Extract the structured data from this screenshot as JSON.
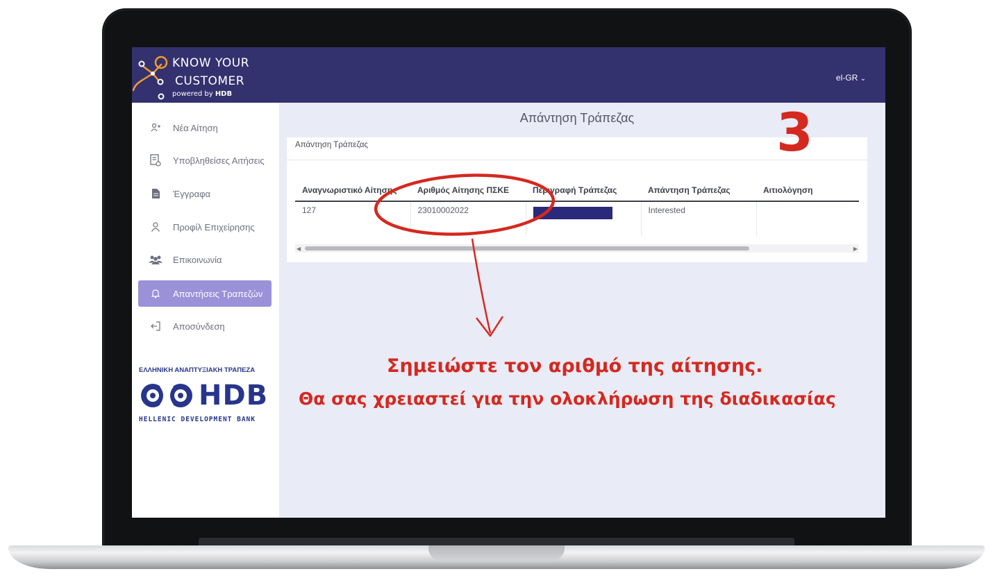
{
  "app": {
    "logo": {
      "line1": "KNOW YOUR",
      "line2": "CUSTOMER",
      "powered_prefix": "powered by ",
      "powered_brand": "HDB"
    },
    "language": "el-GR"
  },
  "sidebar": {
    "items": [
      {
        "label": "Νέα Αίτηση",
        "icon": "add-user-icon"
      },
      {
        "label": "Υποβληθείσες Αιτήσεις",
        "icon": "document-list-icon"
      },
      {
        "label": "Έγγραφα",
        "icon": "document-icon"
      },
      {
        "label": "Προφίλ Επιχείρησης",
        "icon": "user-icon"
      },
      {
        "label": "Επικοινωνία",
        "icon": "group-icon"
      },
      {
        "label": "Απαντήσεις Τραπεζών",
        "icon": "bell-icon",
        "active": true
      },
      {
        "label": "Αποσύνδεση",
        "icon": "logout-icon"
      }
    ],
    "bank_logo": {
      "top": "ΕΛΛΗΝΙΚΗ ΑΝΑΠΤΥΞΙΑΚΗ ΤΡΑΠΕΖΑ",
      "name": "HDB",
      "bottom": "HELLENIC DEVELOPMENT BANK"
    }
  },
  "main": {
    "title": "Απάντηση Τράπεζας",
    "card_label": "Απάντηση Τράπεζας",
    "table": {
      "columns": [
        "Αναγνωριστικό Αίτησης",
        "Αριθμός Αίτησης ΠΣΚΕ",
        "Περιγραφή Τράπεζας",
        "Απάντηση Τράπεζας",
        "Αιτιολόγηση"
      ],
      "rows": [
        [
          "127",
          "23010002022",
          "",
          "Interested",
          ""
        ]
      ]
    }
  },
  "annotation": {
    "step": "3",
    "note_line1": "Σημειώστε τον αριθμό της αίτησης.",
    "note_line2": "Θα σας χρειαστεί για την ολοκλήρωση της διαδικασίας",
    "color": "#d4291f"
  },
  "colors": {
    "header": "#33316e",
    "active_nav": "#9a91d8",
    "screen_bg": "#e9ebf6",
    "brand_blue": "#27358c"
  }
}
